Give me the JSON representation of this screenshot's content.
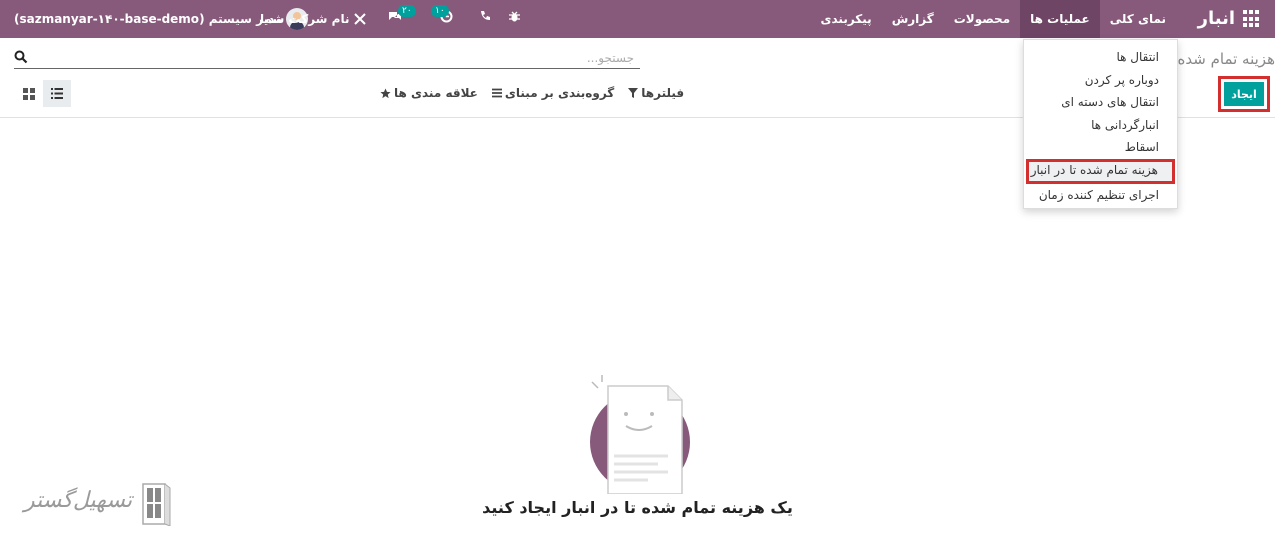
{
  "navbar": {
    "app_name": "انبار",
    "menu": [
      {
        "label": "نمای کلی",
        "active": false
      },
      {
        "label": "عملیات ها",
        "active": true
      },
      {
        "label": "محصولات",
        "active": false
      },
      {
        "label": "گزارش",
        "active": false
      },
      {
        "label": "پیکربندی",
        "active": false
      }
    ],
    "user_label": "مدیر سیستم (sazmanyar-۱۴۰-base-demo)",
    "company_label": "نام شرکت شما",
    "messages_badge": "۲۰",
    "activities_badge": "۱۰",
    "icons": [
      "apps-grid-icon",
      "bug-icon",
      "phone-icon",
      "clock-icon",
      "chat-icon",
      "tools-icon"
    ]
  },
  "control_panel": {
    "title": "هزینه تمام شده تا در انبار",
    "create_label": "ایجاد",
    "search_placeholder": "جستجو...",
    "filters_label": "فیلترها",
    "groupby_label": "گروه‌بندی بر مبنای",
    "favorites_label": "علاقه مندی ها"
  },
  "dropdown": {
    "items": [
      "انتقال ها",
      "دوباره پر کردن",
      "انتقال های دسته ای",
      "انبارگردانی ها",
      "اسقاط",
      "هزینه تمام شده تا در انبار",
      "اجرای تنظیم کننده زمان"
    ],
    "highlighted": "هزینه تمام شده تا در انبار"
  },
  "empty_state": {
    "title": "یک هزینه تمام شده تا در انبار ایجاد کنید"
  },
  "watermark": {
    "text": "تسهیل‌گستر"
  },
  "colors": {
    "navbar": "#875A7B",
    "active_menu": "#6f4565",
    "primary_button": "#00A09D",
    "highlight_border": "#d32f2f"
  }
}
